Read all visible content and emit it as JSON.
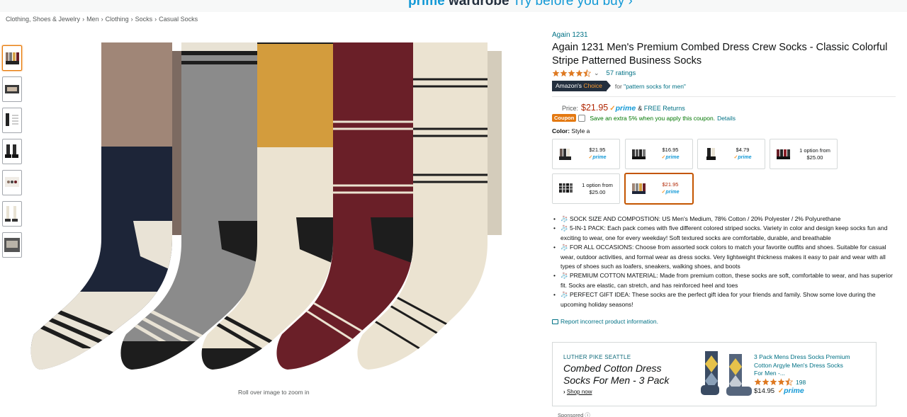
{
  "banner": {
    "part1": "prime",
    "part2": " wardrobe",
    "part3": " Try before you buy ›"
  },
  "breadcrumb": [
    "Clothing, Shoes & Jewelry",
    "Men",
    "Clothing",
    "Socks",
    "Casual Socks"
  ],
  "breadcrumb_sep": "›",
  "zoom_hint": "Roll over image to zoom in",
  "product": {
    "brand": "Again 1231",
    "title": "Again 1231 Men's Premium Combed Dress Crew Socks - Classic Colorful Stripe Patterned Business Socks",
    "rating": 4.5,
    "ratings_count": "57 ratings",
    "choice_badge": {
      "part1": "Amazon's",
      "part2": " Choice"
    },
    "choice_for": "for ",
    "choice_query": "\"pattern socks for men\"",
    "price_label": "Price:",
    "price": "$21.95",
    "prime_check": "✓",
    "prime_word": "prime",
    "free_returns_prefix": "&",
    "free_returns": "FREE Returns",
    "coupon_badge": "Coupon",
    "coupon_text": "Save an extra 5% when you apply this coupon.",
    "coupon_details": "Details",
    "color_label": "Color:",
    "color_value": "Style a",
    "swatches": [
      {
        "price": "$21.95",
        "prime": "prime",
        "sub": ""
      },
      {
        "price": "$16.95",
        "prime": "prime",
        "sub": ""
      },
      {
        "price": "$4.79",
        "prime": "prime",
        "sub": ""
      },
      {
        "price": "",
        "prime": "",
        "sub": "1 option from $25.00"
      },
      {
        "price": "",
        "prime": "",
        "sub": "1 option from $25.00"
      },
      {
        "price": "$21.95",
        "prime": "prime",
        "sub": ""
      }
    ],
    "bullets": [
      "🧦 SOCK SIZE AND COMPOSTION: US Men's Medium, 78% Cotton / 20% Polyester / 2% Polyurethane",
      "🧦 5-IN-1 PACK: Each pack comes with five different colored striped socks. Variety in color and design keep socks fun and exciting to wear, one for every weekday! Soft textured socks are comfortable, durable, and breathable",
      "🧦 FOR ALL OCCASIONS: Choose from assorted sock colors to match your favorite outfits and shoes. Suitable for casual wear, outdoor activities, and formal wear as dress socks. Very lightweight thickness makes it easy to pair and wear with all types of shoes such as loafers, sneakers, walking shoes, and boots",
      "🧦 PREMIUM COTTON MATERIAL: Made from premium cotton, these socks are soft, comfortable to wear, and has superior fit. Socks are elastic, can stretch, and has reinforced heel and toes",
      "🧦 PERFECT GIFT IDEA: These socks are the perfect gift idea for your friends and family. Show some love during the upcoming holiday seasons!"
    ],
    "report": "Report incorrect product information."
  },
  "ad": {
    "brand": "LUTHER PIKE SEATTLE",
    "headline": "Combed Cotton Dress Socks For Men - 3 Pack",
    "shop_arrow": "›",
    "shop": "Shop now",
    "product_title": "3 Pack Mens Dress Socks Premium Cotton Argyle Men's Dress Socks For Men -...",
    "rating": 4.5,
    "rating_count": "198",
    "price": "$14.95",
    "prime_check": "✓",
    "prime_word": "prime"
  },
  "sponsored": "Sponsored ⓘ",
  "colors": {
    "link": "#007185",
    "price": "#b12704",
    "prime": "#1399d6",
    "accent": "#f69931",
    "coupon": "#e47911",
    "success": "#007600"
  }
}
